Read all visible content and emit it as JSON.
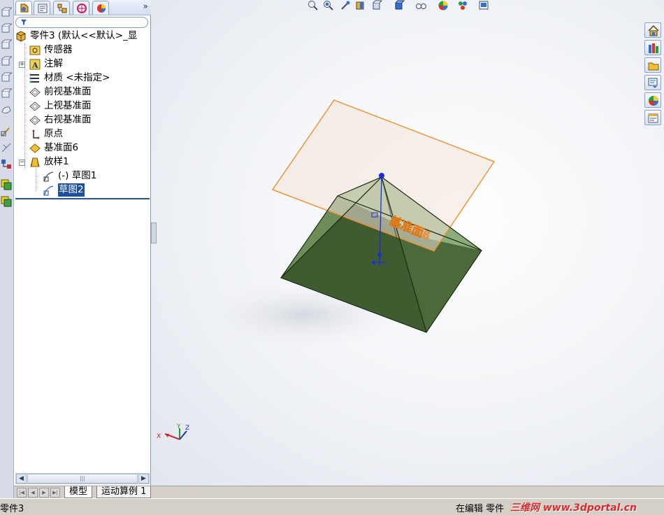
{
  "feature_tree": {
    "root_label": "零件3 (默认<<默认>_显",
    "items": [
      {
        "label": "传感器"
      },
      {
        "label": "注解"
      },
      {
        "label": "材质 <未指定>"
      },
      {
        "label": "前视基准面"
      },
      {
        "label": "上视基准面"
      },
      {
        "label": "右视基准面"
      },
      {
        "label": "原点"
      },
      {
        "label": "基准面6"
      },
      {
        "label": "放样1"
      },
      {
        "label": "(-) 草图1"
      },
      {
        "label": "草图2"
      }
    ],
    "expand_annotations": "+",
    "expand_loft": "−",
    "more_glyph": "»"
  },
  "bottom_tabs": {
    "model": "模型",
    "motion": "运动算例 1"
  },
  "status": {
    "left": "零件3",
    "right": "在编辑 零件",
    "watermark": "三维网 www.3dportal.cn"
  },
  "viewport": {
    "plane_label": "基准面6",
    "triad": {
      "x": "X",
      "y": "Y",
      "z": "Z"
    }
  },
  "colors": {
    "plane_edge": "#f08a1e",
    "plane_fill": "#f4e4d8",
    "pyramid_dark": "#3d5a2e",
    "pyramid_mid": "#56773f",
    "pyramid_light": "#8fb27a",
    "sketch_blue": "#1a2fd8",
    "selection_blue": "#1c4f9c"
  },
  "icons": [
    "feature-manager-icon",
    "property-manager-icon",
    "configuration-manager-icon",
    "dimxpert-icon",
    "display-manager-icon",
    "filter-icon",
    "zoom-fit-icon",
    "zoom-area-icon",
    "previous-view-icon",
    "section-view-icon",
    "view-orientation-icon",
    "display-style-icon",
    "hide-show-icon",
    "appearance-icon",
    "scene-icon",
    "view-settings-icon",
    "home-icon",
    "design-library-icon",
    "file-explorer-icon",
    "view-palette-icon",
    "appearances-icon",
    "custom-properties-icon"
  ]
}
